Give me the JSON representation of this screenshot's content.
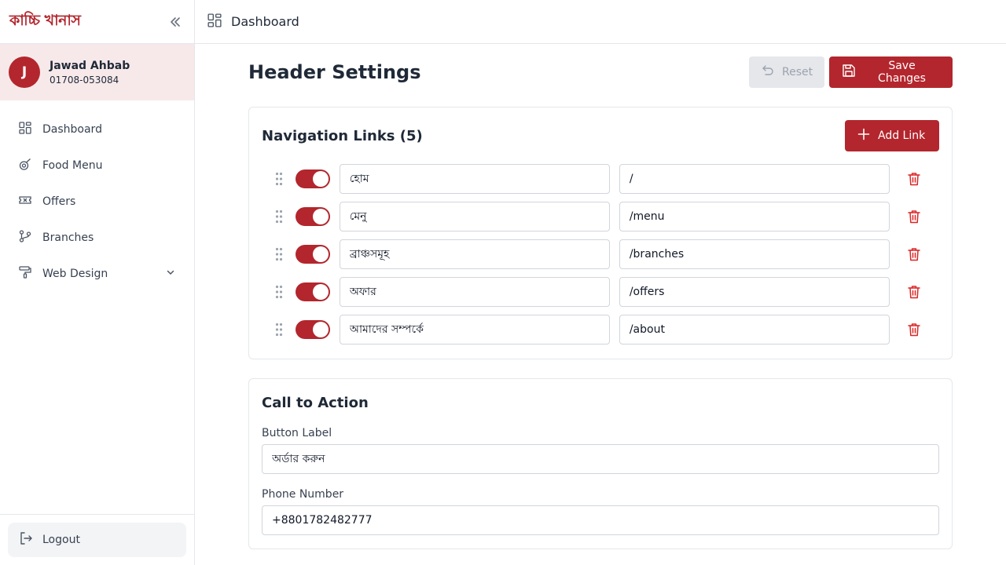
{
  "brand": {
    "logo_text": "কাচ্চি খানাস",
    "accent": "#b3262d"
  },
  "user": {
    "initial": "J",
    "name": "Jawad Ahbab",
    "phone": "01708-053084"
  },
  "sidebar": {
    "items": [
      {
        "label": "Dashboard",
        "icon": "dashboard-icon"
      },
      {
        "label": "Food Menu",
        "icon": "food-menu-icon"
      },
      {
        "label": "Offers",
        "icon": "ticket-icon"
      },
      {
        "label": "Branches",
        "icon": "branches-icon"
      },
      {
        "label": "Web Design",
        "icon": "paint-roller-icon"
      }
    ],
    "logout_label": "Logout"
  },
  "topbar": {
    "breadcrumb": "Dashboard"
  },
  "page": {
    "title": "Header Settings",
    "reset_label": "Reset",
    "save_label": "Save Changes"
  },
  "navigation": {
    "title": "Navigation Links (5)",
    "add_label": "Add Link",
    "links": [
      {
        "label": "হোম",
        "path": "/",
        "enabled": true
      },
      {
        "label": "মেনু",
        "path": "/menu",
        "enabled": true
      },
      {
        "label": "ব্রাঞ্চসমূহ",
        "path": "/branches",
        "enabled": true
      },
      {
        "label": "অফার",
        "path": "/offers",
        "enabled": true
      },
      {
        "label": "আমাদের সম্পর্কে",
        "path": "/about",
        "enabled": true
      }
    ]
  },
  "cta": {
    "title": "Call to Action",
    "button_label_caption": "Button Label",
    "button_label_value": "অর্ডার করুন",
    "phone_caption": "Phone Number",
    "phone_value": "+8801782482777"
  }
}
